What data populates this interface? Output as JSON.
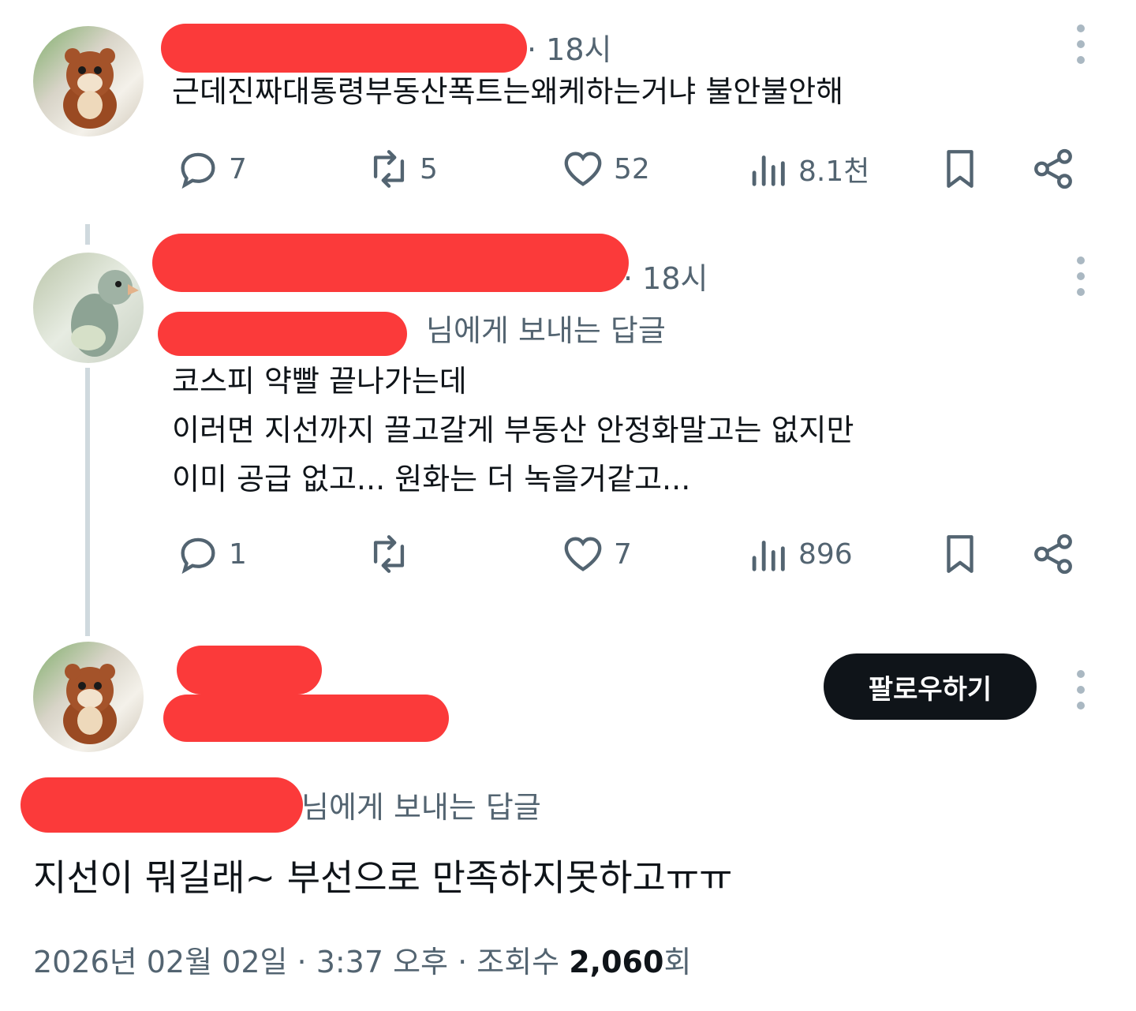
{
  "tweet1": {
    "time": "· 18시",
    "text": "근데진짜대통령부동산폭트는왜케하는거냐 불안불안해",
    "replies": "7",
    "retweets": "5",
    "likes": "52",
    "views": "8.1천"
  },
  "tweet2": {
    "time": "· 18시",
    "reply_to_suffix": "님에게 보내는 답글",
    "text": "코스피 약빨 끝나가는데\n이러면 지선까지 끌고갈게 부동산 안정화말고는 없지만\n이미 공급 없고... 원화는 더 녹을거같고...",
    "replies": "1",
    "retweets": "",
    "likes": "7",
    "views": "896"
  },
  "tweet3": {
    "follow_label": "팔로우하기",
    "reply_to_suffix": "님에게 보내는 답글",
    "text": "지선이 뭐길래~ 부선으로 만족하지못하고ㅠㅠ",
    "date": "2026년 02월 02일 · 3:37 오후 · 조회수 ",
    "views_count": "2,060",
    "views_unit": "회"
  },
  "icons": [
    "reply-icon",
    "retweet-icon",
    "like-icon",
    "views-icon",
    "bookmark-icon",
    "share-icon",
    "more-icon"
  ],
  "colors": {
    "redaction": "#fb3a3a",
    "mention": "#1d9bf0",
    "muted": "#536471",
    "button": "#0f1419"
  }
}
